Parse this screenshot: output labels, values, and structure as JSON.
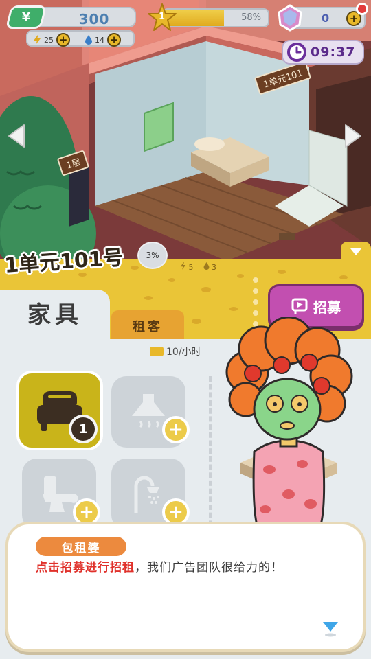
{
  "hud": {
    "money": "300",
    "money_symbol": "¥",
    "energy": "25",
    "water": "14",
    "level": "1",
    "level_progress_pct": "58%",
    "level_progress": 0.58,
    "gems": "0",
    "timer": "09:37"
  },
  "scene": {
    "unit_sign": "1单元101",
    "floor_sign": "1层"
  },
  "room": {
    "title": "1单元101号",
    "completion": "3%",
    "energy_cost": "5",
    "water_cost": "3"
  },
  "panel": {
    "tab_furniture": "家具",
    "tab_tenant": "租客",
    "recruit_label": "招募",
    "rate": "10/小时",
    "bed_count": "1"
  },
  "dialog": {
    "speaker": "包租婆",
    "highlight": "点击招募进行招租",
    "text": "，我们广告团队很给力的！"
  },
  "colors": {
    "panel": "#eac537",
    "recruit": "#c24fb0",
    "money_badge": "#3fae6a",
    "speaker": "#ec8a3e",
    "highlight": "#e0312b"
  },
  "icons": [
    "money-icon",
    "lightning-icon",
    "water-drop-icon",
    "star-icon",
    "gem-icon",
    "clock-icon",
    "bed-icon",
    "range-hood-icon",
    "toilet-icon",
    "shower-icon",
    "recruit-icon",
    "chevron-left-icon",
    "chevron-right-icon",
    "chevron-down-icon"
  ]
}
